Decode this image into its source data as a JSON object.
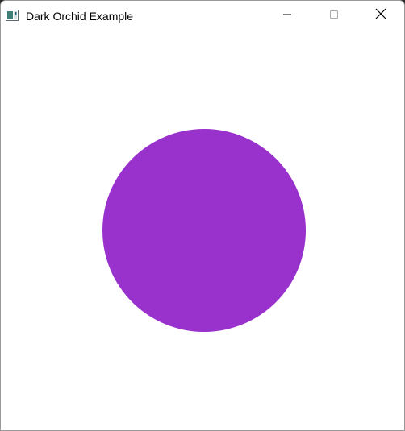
{
  "window": {
    "title": "Dark Orchid Example",
    "icon": "app-window-icon"
  },
  "controls": {
    "minimize": "minimize-icon",
    "maximize": "maximize-icon",
    "close": "close-icon"
  },
  "canvas": {
    "background": "#ffffff",
    "shape": "circle",
    "fill_color": "#9932CC"
  }
}
